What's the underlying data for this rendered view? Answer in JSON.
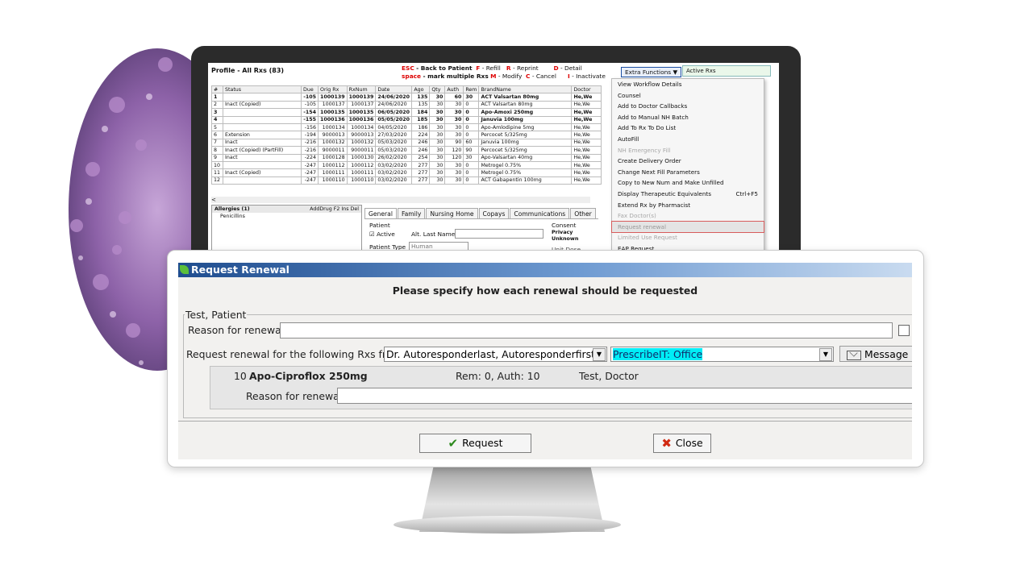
{
  "screen": {
    "profile_title": "Profile - All Rxs (83)",
    "keys": {
      "esc_key": "ESC",
      "esc_label": "- Back to Patient",
      "space_key": "space",
      "space_label": "- mark multiple Rxs",
      "f_key": "F",
      "f_label": "- Refill",
      "m_key": "M",
      "m_label": "- Modify",
      "r_key": "R",
      "r_label": "- Reprint",
      "c_key": "C",
      "c_label": "- Cancel",
      "d_key": "D",
      "d_label": "- Detail",
      "i_key": "I",
      "i_label": "- Inactivate"
    },
    "extra_functions": "Extra Functions ▼",
    "active_rxs": "Active Rxs",
    "columns": [
      "#",
      "Status",
      "Due",
      "Orig Rx",
      "RxNum",
      "Date",
      "Ago",
      "Qty",
      "Auth",
      "Rem",
      "BrandName",
      "Doctor"
    ],
    "rows": [
      {
        "c": [
          "1",
          "",
          "-105",
          "1000139",
          "1000139",
          "24/06/2020",
          "135",
          "30",
          "60",
          "30",
          "ACT Valsartan 80mg",
          "He,We"
        ],
        "bold": true
      },
      {
        "c": [
          "2",
          "Inact (Copied)",
          "-105",
          "1000137",
          "1000137",
          "24/06/2020",
          "135",
          "30",
          "30",
          "0",
          "ACT Valsartan 80mg",
          "He,We"
        ],
        "bold": false
      },
      {
        "c": [
          "3",
          "",
          "-154",
          "1000135",
          "1000135",
          "06/05/2020",
          "184",
          "30",
          "30",
          "0",
          "Apo-Amoxi 250mg",
          "He,We"
        ],
        "bold": true
      },
      {
        "c": [
          "4",
          "",
          "-155",
          "1000136",
          "1000136",
          "05/05/2020",
          "185",
          "30",
          "30",
          "0",
          "Januvia 100mg",
          "He,We"
        ],
        "bold": true
      },
      {
        "c": [
          "5",
          "",
          "-156",
          "1000134",
          "1000134",
          "04/05/2020",
          "186",
          "30",
          "30",
          "0",
          "Apo-Amlodipine 5mg",
          "He,We"
        ],
        "bold": false
      },
      {
        "c": [
          "6",
          "Extension",
          "-194",
          "9000013",
          "9000013",
          "27/03/2020",
          "224",
          "30",
          "30",
          "0",
          "Percocet 5/325mg",
          "He,We"
        ],
        "bold": false
      },
      {
        "c": [
          "7",
          "Inact",
          "-216",
          "1000132",
          "1000132",
          "05/03/2020",
          "246",
          "30",
          "90",
          "60",
          "Januvia 100mg",
          "He,We"
        ],
        "bold": false
      },
      {
        "c": [
          "8",
          "Inact (Copied) (PartFill)",
          "-216",
          "9000011",
          "9000011",
          "05/03/2020",
          "246",
          "30",
          "120",
          "90",
          "Percocet 5/325mg",
          "He,We"
        ],
        "bold": false
      },
      {
        "c": [
          "9",
          "Inact",
          "-224",
          "1000128",
          "1000130",
          "26/02/2020",
          "254",
          "30",
          "120",
          "30",
          "Apo-Valsartan 40mg",
          "He,We"
        ],
        "bold": false
      },
      {
        "c": [
          "10",
          "",
          "-247",
          "1000112",
          "1000112",
          "03/02/2020",
          "277",
          "30",
          "30",
          "0",
          "Metrogel 0.75%",
          "He,We"
        ],
        "bold": false
      },
      {
        "c": [
          "11",
          "Inact (Copied)",
          "-247",
          "1000111",
          "1000111",
          "03/02/2020",
          "277",
          "30",
          "30",
          "0",
          "Metrogel 0.75%",
          "He,We"
        ],
        "bold": false
      },
      {
        "c": [
          "12",
          "",
          "-247",
          "1000110",
          "1000110",
          "03/02/2020",
          "277",
          "30",
          "30",
          "0",
          "ACT Gabapentin 100mg",
          "He,We"
        ],
        "bold": false
      }
    ],
    "scroll_left": "<",
    "allergies_title": "Allergies (1)",
    "allergies_tools": "AddDrug  F2  Ins  Del",
    "allergy_item": "Penicillins",
    "tabs": [
      "General",
      "Family",
      "Nursing Home",
      "Copays",
      "Communications",
      "Other"
    ],
    "patient_label": "Patient",
    "active_label": "Active",
    "alt_last_name": "Alt. Last Name",
    "patient_type_label": "Patient Type",
    "patient_type_value": "Human",
    "consent_label": "Consent",
    "privacy_label": "Privacy Unknown",
    "unit_dose": "Unit Dose",
    "menu_items": [
      {
        "label": "View Workflow Details",
        "shortcut": "",
        "state": "normal"
      },
      {
        "label": "Counsel",
        "shortcut": "",
        "state": "normal"
      },
      {
        "label": "Add to Doctor Callbacks",
        "shortcut": "",
        "state": "normal"
      },
      {
        "label": "Add to Manual NH Batch",
        "shortcut": "",
        "state": "normal"
      },
      {
        "label": "Add To Rx To Do List",
        "shortcut": "",
        "state": "normal"
      },
      {
        "label": "AutoFill",
        "shortcut": "",
        "state": "normal"
      },
      {
        "label": "NH Emergency Fill",
        "shortcut": "",
        "state": "disabled"
      },
      {
        "label": "Create Delivery Order",
        "shortcut": "",
        "state": "normal"
      },
      {
        "label": "Change Next Fill Parameters",
        "shortcut": "",
        "state": "normal"
      },
      {
        "label": "Copy to New Num and Make Unfilled",
        "shortcut": "",
        "state": "normal"
      },
      {
        "label": "Display Therapeutic Equivalents",
        "shortcut": "Ctrl+F5",
        "state": "normal"
      },
      {
        "label": "Extend Rx by Pharmacist",
        "shortcut": "",
        "state": "normal"
      },
      {
        "label": "Fax Doctor(s)",
        "shortcut": "",
        "state": "disabled"
      },
      {
        "label": "Request renewal",
        "shortcut": "",
        "state": "highlighted"
      },
      {
        "label": "Limited Use Request",
        "shortcut": "",
        "state": "disabled"
      },
      {
        "label": "EAP Request",
        "shortcut": "",
        "state": "normal"
      }
    ]
  },
  "dialog": {
    "title": "Request Renewal",
    "heading": "Please specify how each renewal should be requested",
    "patient_group": "Test, Patient",
    "reason_label": "Reason for renewal",
    "reason_value": "",
    "from_label": "Request renewal for the following Rxs from",
    "doctor_value": "Dr. Autoresponderlast, Autoresponderfirst",
    "method_value": "PrescribeIT: Office",
    "message_button": "Message",
    "rx_number": "10",
    "rx_drug": "Apo-Ciproflox 250mg",
    "rx_rem_auth": "Rem: 0, Auth: 10",
    "rx_doctor": "Test, Doctor",
    "rx_reason_label": "Reason for renewal",
    "rx_reason_value": "",
    "request_button": "Request",
    "close_button": "Close"
  },
  "colors": {
    "accent_cyan": "#00eef6",
    "title_bar": "#1f4d8f",
    "highlight_outline": "#d75c5c"
  }
}
